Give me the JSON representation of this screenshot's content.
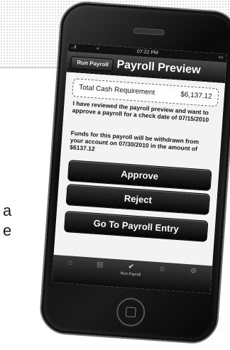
{
  "background": {
    "text_line_1": "a",
    "text_line_2": "e"
  },
  "status_bar": {
    "time": "07:22 PM",
    "signal": "..ıl",
    "wifi": "≈",
    "battery": "▭"
  },
  "nav": {
    "back_label": "Run Payroll",
    "title": "Payroll Preview"
  },
  "summary": {
    "total_label": "Total Cash Requirement",
    "total_value": "$6,137.12"
  },
  "messages": {
    "review": "I have reviewed the payroll preview and want to approve a payroll for a check date of 07/15/2010",
    "funds": "Funds for this payroll will be withdrawn from your account on 07/30/2010 in the amount of $6137.12"
  },
  "actions": {
    "approve": "Approve",
    "reject": "Reject",
    "go_to_entry": "Go To Payroll Entry"
  },
  "tab_bar": {
    "active_label": "Run Payroll",
    "icons": [
      "home-icon",
      "document-icon",
      "checkmark-icon",
      "people-icon",
      "settings-icon"
    ]
  },
  "colors": {
    "button": "#111111",
    "nav": "#2a2a2a",
    "screen": "#f1f1f1"
  }
}
